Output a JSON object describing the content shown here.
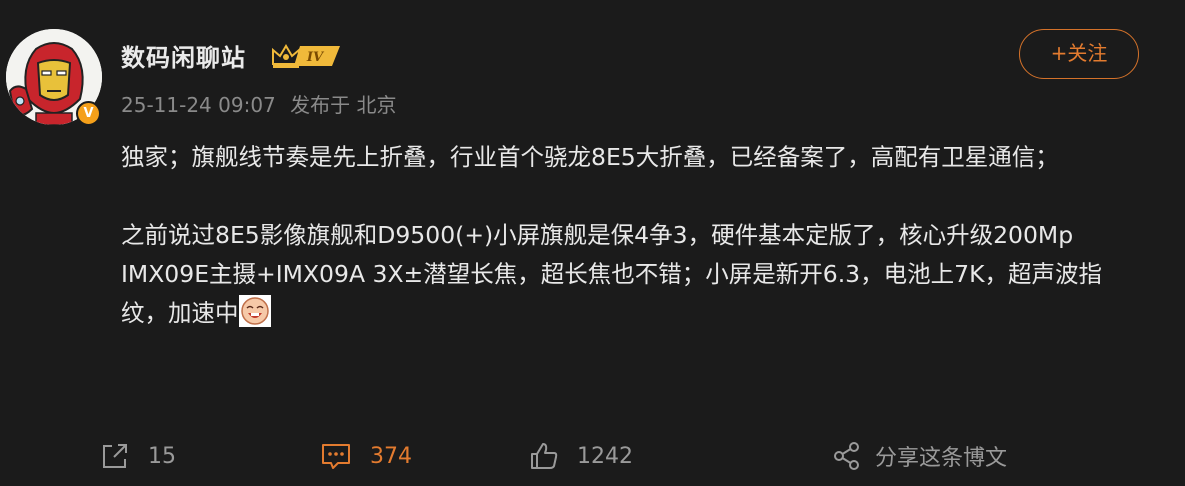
{
  "post": {
    "username": "数码闲聊站",
    "vip_level": "IV",
    "verified_badge": "V",
    "timestamp": "25-11-24 09:07",
    "source": "发布于 北京",
    "follow_label": "+关注",
    "paragraphs": [
      "独家；旗舰线节奏是先上折叠，行业首个骁龙8E5大折叠，已经备案了，高配有卫星通信；",
      "之前说过8E5影像旗舰和D9500(+)小屏旗舰是保4争3，硬件基本定版了，核心升级200Mp IMX09E主摄+IMX09A 3X±潜望长焦，超长焦也不错；小屏是新开6.3，电池上7K，超声波指纹，加速中"
    ]
  },
  "actions": {
    "share_count": "15",
    "comment_count": "374",
    "like_count": "1242",
    "share_label": "分享这条博文"
  },
  "icons": {
    "avatar": "iron-man-avatar",
    "vip": "crown-icon",
    "repost": "repost-icon",
    "comment": "comment-icon",
    "like": "thumbs-up-icon",
    "share": "share-icon",
    "emoji": "laughing-emoji-icon"
  },
  "colors": {
    "background": "#1b1b1b",
    "accent": "#e37b2f",
    "text": "#e8e8e8",
    "muted": "#8a8a8a"
  }
}
